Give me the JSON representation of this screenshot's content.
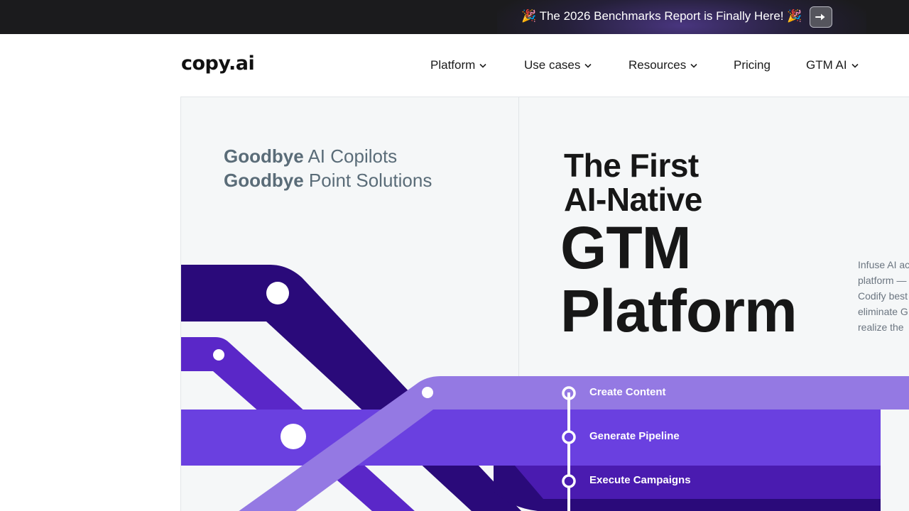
{
  "announcement": {
    "text": "🎉 The 2026 Benchmarks Report is Finally Here! 🎉",
    "button_icon": "arrow-right-icon"
  },
  "nav": {
    "logo": "copy.ai",
    "items": [
      {
        "label": "Platform",
        "has_dropdown": true
      },
      {
        "label": "Use cases",
        "has_dropdown": true
      },
      {
        "label": "Resources",
        "has_dropdown": true
      },
      {
        "label": "Pricing",
        "has_dropdown": false
      },
      {
        "label": "GTM AI",
        "has_dropdown": true
      }
    ]
  },
  "hero": {
    "goodbye_lines": [
      {
        "bold": "Goodbye",
        "rest": " AI Copilots"
      },
      {
        "bold": "Goodbye",
        "rest": " Point Solutions"
      }
    ],
    "headline": {
      "line1": "The First",
      "line2": "AI-Native",
      "line3": "GTM",
      "line4": "Platform"
    },
    "description_lines": [
      "Infuse AI ac",
      "platform —",
      "Codify best",
      "eliminate G",
      "realize the"
    ],
    "steps": [
      "Create Content",
      "Generate Pipeline",
      "Execute Campaigns"
    ]
  },
  "colors": {
    "announce_bg": "#1b1b1d",
    "hero_bg": "#f5f7f8",
    "deep_purple": "#2a0a7a",
    "mid_purple": "#5b2ed1",
    "bright_purple": "#6a40e0",
    "light_purple": "#9479e3"
  }
}
